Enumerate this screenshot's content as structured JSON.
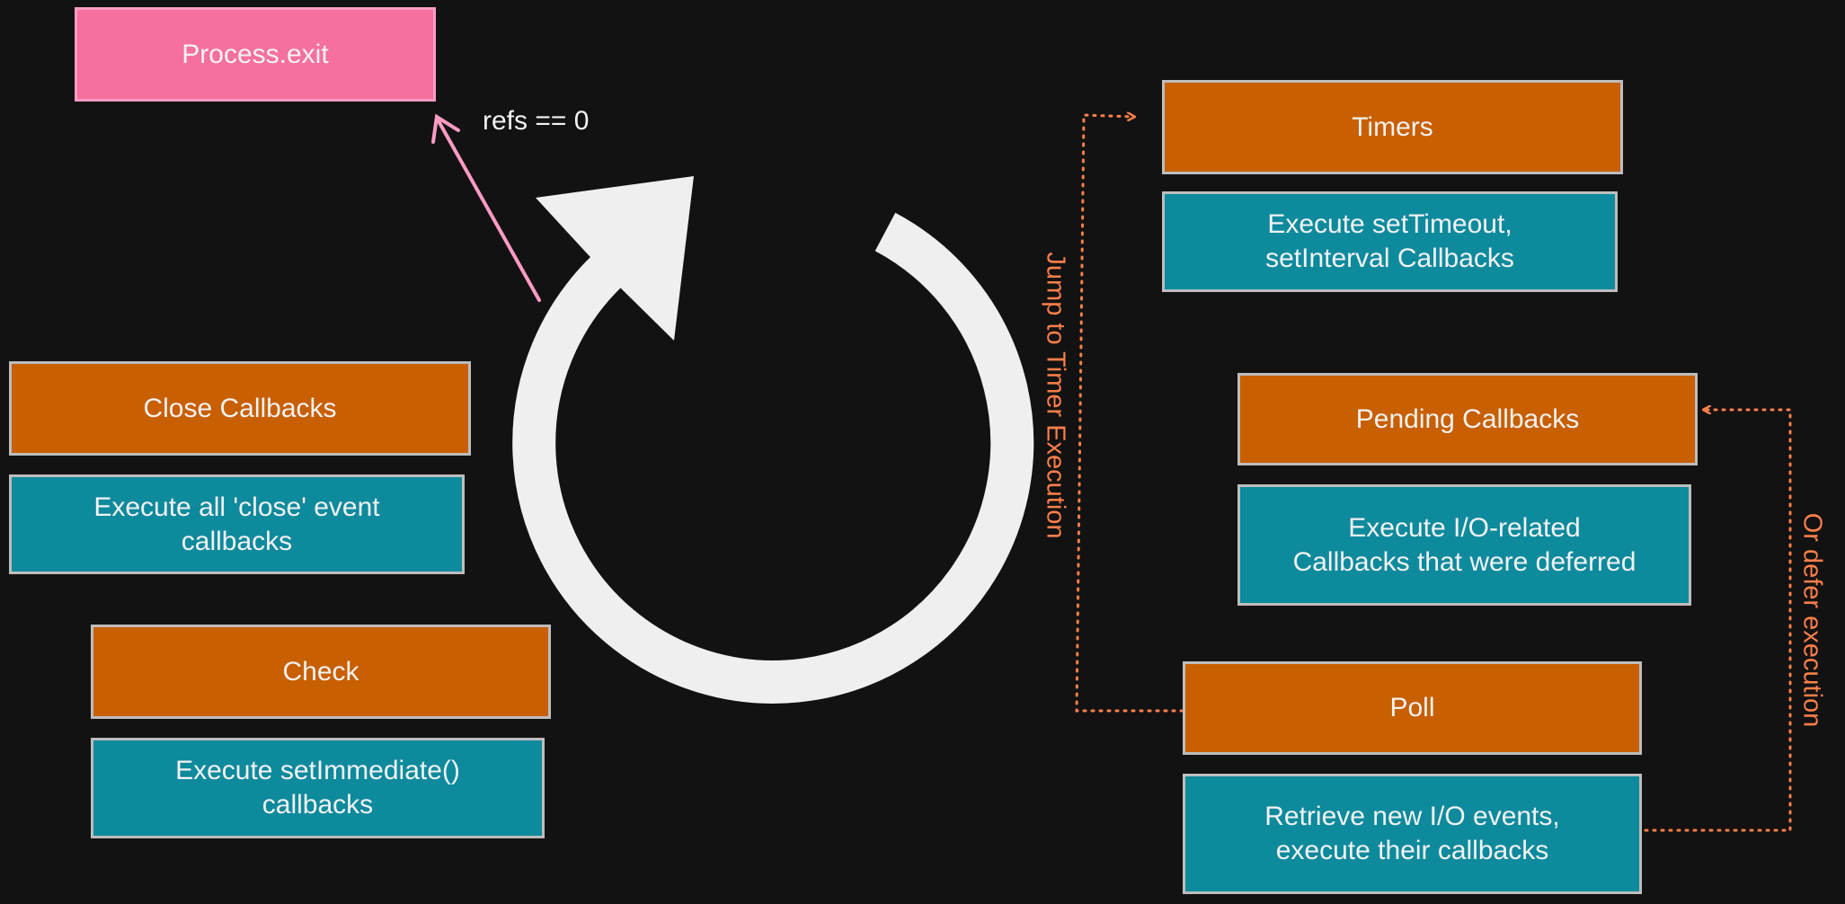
{
  "process_exit": {
    "label": "Process.exit"
  },
  "refs_label": "refs == 0",
  "phases": {
    "timers": {
      "title": "Timers",
      "desc": "Execute setTimeout,\nsetInterval Callbacks"
    },
    "pending": {
      "title": "Pending Callbacks",
      "desc": "Execute I/O-related\nCallbacks that were deferred"
    },
    "poll": {
      "title": "Poll",
      "desc": "Retrieve new I/O events,\nexecute their callbacks"
    },
    "check": {
      "title": "Check",
      "desc": "Execute setImmediate()\ncallbacks"
    },
    "close": {
      "title": "Close Callbacks",
      "desc": "Execute all 'close' event\ncallbacks"
    }
  },
  "annotations": {
    "jump": "Jump to Timer Execution",
    "defer": "Or defer execution"
  },
  "colors": {
    "phase": "#c85f00",
    "description": "#0e8a9d",
    "exit": "#f5709f",
    "annotation": "#ff7f4a",
    "loop_arrow": "#efefef"
  }
}
